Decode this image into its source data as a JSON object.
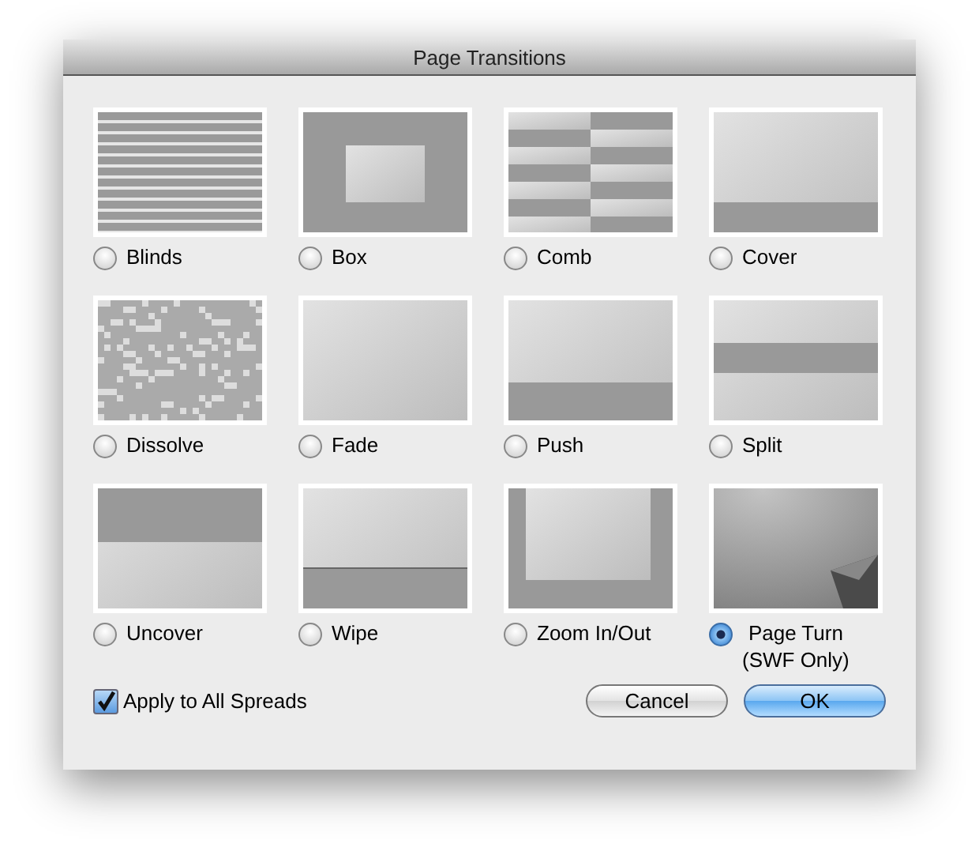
{
  "window": {
    "title": "Page Transitions"
  },
  "transitions": [
    {
      "label": "Blinds",
      "kind": "blinds",
      "selected": false
    },
    {
      "label": "Box",
      "kind": "box",
      "selected": false
    },
    {
      "label": "Comb",
      "kind": "comb",
      "selected": false
    },
    {
      "label": "Cover",
      "kind": "cover",
      "selected": false
    },
    {
      "label": "Dissolve",
      "kind": "dissolve",
      "selected": false
    },
    {
      "label": "Fade",
      "kind": "fade",
      "selected": false
    },
    {
      "label": "Push",
      "kind": "push",
      "selected": false
    },
    {
      "label": "Split",
      "kind": "split",
      "selected": false
    },
    {
      "label": "Uncover",
      "kind": "uncover",
      "selected": false
    },
    {
      "label": "Wipe",
      "kind": "wipe",
      "selected": false
    },
    {
      "label": "Zoom In/Out",
      "kind": "zoom",
      "selected": false
    },
    {
      "label": "Page Turn",
      "note": "(SWF Only)",
      "kind": "pageturn",
      "selected": true
    }
  ],
  "apply_all": {
    "label": "Apply to All Spreads",
    "checked": true
  },
  "buttons": [
    {
      "label": "Cancel",
      "default": false
    },
    {
      "label": "OK",
      "default": true
    }
  ]
}
